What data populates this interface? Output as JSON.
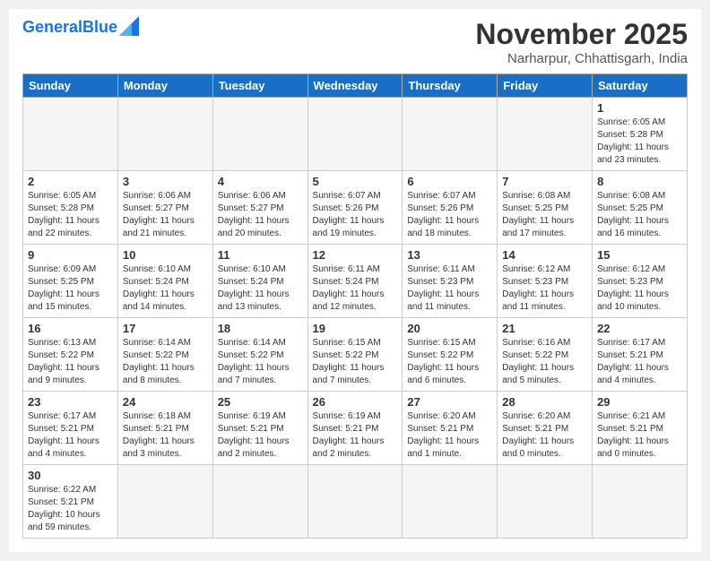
{
  "header": {
    "logo_general": "General",
    "logo_blue": "Blue",
    "month_title": "November 2025",
    "subtitle": "Narharpur, Chhattisgarh, India"
  },
  "weekdays": [
    "Sunday",
    "Monday",
    "Tuesday",
    "Wednesday",
    "Thursday",
    "Friday",
    "Saturday"
  ],
  "weeks": [
    [
      {
        "day": "",
        "info": ""
      },
      {
        "day": "",
        "info": ""
      },
      {
        "day": "",
        "info": ""
      },
      {
        "day": "",
        "info": ""
      },
      {
        "day": "",
        "info": ""
      },
      {
        "day": "",
        "info": ""
      },
      {
        "day": "1",
        "info": "Sunrise: 6:05 AM\nSunset: 5:28 PM\nDaylight: 11 hours\nand 23 minutes."
      }
    ],
    [
      {
        "day": "2",
        "info": "Sunrise: 6:05 AM\nSunset: 5:28 PM\nDaylight: 11 hours\nand 22 minutes."
      },
      {
        "day": "3",
        "info": "Sunrise: 6:06 AM\nSunset: 5:27 PM\nDaylight: 11 hours\nand 21 minutes."
      },
      {
        "day": "4",
        "info": "Sunrise: 6:06 AM\nSunset: 5:27 PM\nDaylight: 11 hours\nand 20 minutes."
      },
      {
        "day": "5",
        "info": "Sunrise: 6:07 AM\nSunset: 5:26 PM\nDaylight: 11 hours\nand 19 minutes."
      },
      {
        "day": "6",
        "info": "Sunrise: 6:07 AM\nSunset: 5:26 PM\nDaylight: 11 hours\nand 18 minutes."
      },
      {
        "day": "7",
        "info": "Sunrise: 6:08 AM\nSunset: 5:25 PM\nDaylight: 11 hours\nand 17 minutes."
      },
      {
        "day": "8",
        "info": "Sunrise: 6:08 AM\nSunset: 5:25 PM\nDaylight: 11 hours\nand 16 minutes."
      }
    ],
    [
      {
        "day": "9",
        "info": "Sunrise: 6:09 AM\nSunset: 5:25 PM\nDaylight: 11 hours\nand 15 minutes."
      },
      {
        "day": "10",
        "info": "Sunrise: 6:10 AM\nSunset: 5:24 PM\nDaylight: 11 hours\nand 14 minutes."
      },
      {
        "day": "11",
        "info": "Sunrise: 6:10 AM\nSunset: 5:24 PM\nDaylight: 11 hours\nand 13 minutes."
      },
      {
        "day": "12",
        "info": "Sunrise: 6:11 AM\nSunset: 5:24 PM\nDaylight: 11 hours\nand 12 minutes."
      },
      {
        "day": "13",
        "info": "Sunrise: 6:11 AM\nSunset: 5:23 PM\nDaylight: 11 hours\nand 11 minutes."
      },
      {
        "day": "14",
        "info": "Sunrise: 6:12 AM\nSunset: 5:23 PM\nDaylight: 11 hours\nand 11 minutes."
      },
      {
        "day": "15",
        "info": "Sunrise: 6:12 AM\nSunset: 5:23 PM\nDaylight: 11 hours\nand 10 minutes."
      }
    ],
    [
      {
        "day": "16",
        "info": "Sunrise: 6:13 AM\nSunset: 5:22 PM\nDaylight: 11 hours\nand 9 minutes."
      },
      {
        "day": "17",
        "info": "Sunrise: 6:14 AM\nSunset: 5:22 PM\nDaylight: 11 hours\nand 8 minutes."
      },
      {
        "day": "18",
        "info": "Sunrise: 6:14 AM\nSunset: 5:22 PM\nDaylight: 11 hours\nand 7 minutes."
      },
      {
        "day": "19",
        "info": "Sunrise: 6:15 AM\nSunset: 5:22 PM\nDaylight: 11 hours\nand 7 minutes."
      },
      {
        "day": "20",
        "info": "Sunrise: 6:15 AM\nSunset: 5:22 PM\nDaylight: 11 hours\nand 6 minutes."
      },
      {
        "day": "21",
        "info": "Sunrise: 6:16 AM\nSunset: 5:22 PM\nDaylight: 11 hours\nand 5 minutes."
      },
      {
        "day": "22",
        "info": "Sunrise: 6:17 AM\nSunset: 5:21 PM\nDaylight: 11 hours\nand 4 minutes."
      }
    ],
    [
      {
        "day": "23",
        "info": "Sunrise: 6:17 AM\nSunset: 5:21 PM\nDaylight: 11 hours\nand 4 minutes."
      },
      {
        "day": "24",
        "info": "Sunrise: 6:18 AM\nSunset: 5:21 PM\nDaylight: 11 hours\nand 3 minutes."
      },
      {
        "day": "25",
        "info": "Sunrise: 6:19 AM\nSunset: 5:21 PM\nDaylight: 11 hours\nand 2 minutes."
      },
      {
        "day": "26",
        "info": "Sunrise: 6:19 AM\nSunset: 5:21 PM\nDaylight: 11 hours\nand 2 minutes."
      },
      {
        "day": "27",
        "info": "Sunrise: 6:20 AM\nSunset: 5:21 PM\nDaylight: 11 hours\nand 1 minute."
      },
      {
        "day": "28",
        "info": "Sunrise: 6:20 AM\nSunset: 5:21 PM\nDaylight: 11 hours\nand 0 minutes."
      },
      {
        "day": "29",
        "info": "Sunrise: 6:21 AM\nSunset: 5:21 PM\nDaylight: 11 hours\nand 0 minutes."
      }
    ],
    [
      {
        "day": "30",
        "info": "Sunrise: 6:22 AM\nSunset: 5:21 PM\nDaylight: 10 hours\nand 59 minutes."
      },
      {
        "day": "",
        "info": ""
      },
      {
        "day": "",
        "info": ""
      },
      {
        "day": "",
        "info": ""
      },
      {
        "day": "",
        "info": ""
      },
      {
        "day": "",
        "info": ""
      },
      {
        "day": "",
        "info": ""
      }
    ]
  ]
}
